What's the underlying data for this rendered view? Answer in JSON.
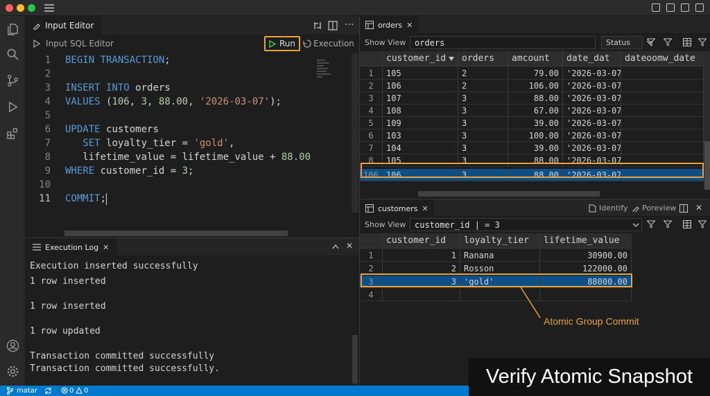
{
  "editor": {
    "tab_label": "Input Editor",
    "toolbar_title": "Input SQL Editor",
    "run_label": "Run",
    "execution_label": "Execution",
    "lines": [
      {
        "n": "1",
        "parts": [
          [
            "kw",
            "BEGIN TRANSACTION"
          ],
          [
            "id",
            ";"
          ]
        ]
      },
      {
        "n": "2",
        "parts": []
      },
      {
        "n": "3",
        "parts": [
          [
            "kw",
            "INSERT INTO "
          ],
          [
            "id",
            "orders"
          ]
        ]
      },
      {
        "n": "4",
        "parts": [
          [
            "kw",
            "VALUES "
          ],
          [
            "id",
            "("
          ],
          [
            "num",
            "106"
          ],
          [
            "id",
            ", "
          ],
          [
            "num",
            "3"
          ],
          [
            "id",
            ", "
          ],
          [
            "num",
            "88.00"
          ],
          [
            "id",
            ", "
          ],
          [
            "str",
            "'2026-03-07'"
          ],
          [
            "id",
            ");"
          ]
        ]
      },
      {
        "n": "5",
        "parts": []
      },
      {
        "n": "6",
        "parts": [
          [
            "kw",
            "UPDATE "
          ],
          [
            "id",
            "customers"
          ]
        ]
      },
      {
        "n": "7",
        "parts": [
          [
            "id",
            "   "
          ],
          [
            "kw",
            "SET "
          ],
          [
            "id",
            "loyalty_tier = "
          ],
          [
            "str",
            "'gold'"
          ],
          [
            "id",
            ","
          ]
        ]
      },
      {
        "n": "8",
        "parts": [
          [
            "id",
            "   lifetime_value = lifetime_value + "
          ],
          [
            "num",
            "88.00"
          ]
        ]
      },
      {
        "n": "9",
        "parts": [
          [
            "kw",
            "WHERE "
          ],
          [
            "id",
            "customer_id = "
          ],
          [
            "num",
            "3"
          ],
          [
            "id",
            ";"
          ]
        ]
      },
      {
        "n": "10",
        "parts": []
      },
      {
        "n": "11",
        "parts": [
          [
            "kw",
            "COMMIT"
          ],
          [
            "id",
            ";"
          ]
        ]
      }
    ]
  },
  "log": {
    "tab_label": "Execution Log",
    "lines": [
      "Execution inserted successfully",
      "1 row inserted",
      "",
      "1 row inserted",
      "",
      "1 row updated",
      "",
      "Transaction committed successfully",
      "Transaction committed successfully."
    ]
  },
  "orders": {
    "tab_label": "orders",
    "show_view_label": "Show View",
    "filter_value": "orders",
    "status_label": "Status",
    "columns": [
      "customer_id",
      "orders",
      "amcount",
      "date_dat",
      "dateoomw_date"
    ],
    "rows": [
      [
        "1",
        "105",
        "2",
        "79.00",
        "'2026-03-07"
      ],
      [
        "2",
        "106",
        "2",
        "106.00",
        "'2026-03-07"
      ],
      [
        "3",
        "107",
        "3",
        "88.00",
        "'2026-03-07"
      ],
      [
        "4",
        "108",
        "3",
        "67.00",
        "'2026-03-07"
      ],
      [
        "5",
        "109",
        "3",
        "39.00",
        "'2026-03-07"
      ],
      [
        "6",
        "103",
        "3",
        "100.00",
        "'2026-03-07"
      ],
      [
        "7",
        "104",
        "3",
        "39.00",
        "'2026-03-07"
      ],
      [
        "8",
        "105",
        "3",
        "88.00",
        "'2026-03-07"
      ],
      [
        "106",
        "106",
        "3",
        "88.00",
        "'2026-03-07"
      ]
    ]
  },
  "customers": {
    "tab_label": "customers",
    "identify_label": "Identify",
    "poreview_label": "Poreview",
    "show_view_label": "Show View",
    "filter_value": "customer_id | = 3",
    "columns": [
      "customer_id",
      "loyalty_tier",
      "lifetime_value"
    ],
    "rows": [
      [
        "1",
        "1",
        "Ranana",
        "30900.00"
      ],
      [
        "2",
        "2",
        "Rosson",
        "122000.00"
      ],
      [
        "3",
        "3",
        "'gold'",
        "88000.00"
      ],
      [
        "4",
        "",
        "",
        ""
      ]
    ]
  },
  "callout": "Atomic Group Commit",
  "caption": "Verify Atomic Snapshot",
  "status": {
    "branch": "matar",
    "problems": "0",
    "warnings": "0"
  },
  "colors": {
    "accent": "#e8a33d",
    "selection": "#0e4f88",
    "statusbar": "#007acc"
  }
}
